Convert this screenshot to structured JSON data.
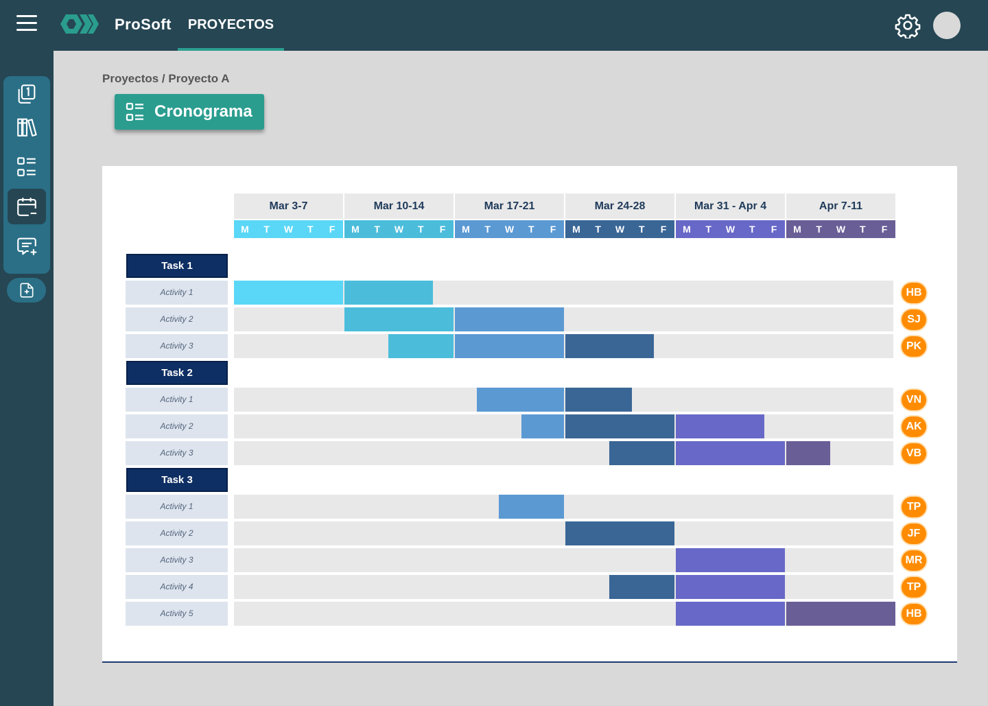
{
  "app": {
    "brand": "ProSoft",
    "nav_tab": "PROYECTOS"
  },
  "breadcrumb": "Proyectos / Proyecto A",
  "page_button": {
    "label": "Cronograma",
    "icon": "schedule-list-icon"
  },
  "sidebar": {
    "items": [
      {
        "name": "duplicate-icon",
        "active": false
      },
      {
        "name": "library-icon",
        "active": false
      },
      {
        "name": "list-icon",
        "active": false
      },
      {
        "name": "calendar-icon",
        "active": true
      },
      {
        "name": "comment-add-icon",
        "active": false
      }
    ],
    "add_item": "file-add-icon"
  },
  "colors": {
    "topbar": "#264653",
    "accent": "#2a9d8f",
    "badge": "#ff8c00",
    "week_colors": [
      "#5ad7f6",
      "#4bbddb",
      "#5b99d3",
      "#3a6696",
      "#6868c8",
      "#6a5e97"
    ]
  },
  "chart_data": {
    "type": "gantt",
    "weeks": [
      "Mar 3-7",
      "Mar 10-14",
      "Mar 17-21",
      "Mar 24-28",
      "Mar 31 - Apr 4",
      "Apr 7-11"
    ],
    "day_labels": [
      "M",
      "T",
      "W",
      "T",
      "F"
    ],
    "groups": [
      {
        "task": "Task 1",
        "activities": [
          {
            "label": "Activity 1",
            "assignee": "HB",
            "start": 0,
            "end": 1.8
          },
          {
            "label": "Activity 2",
            "assignee": "SJ",
            "start": 1,
            "end": 3
          },
          {
            "label": "Activity 3",
            "assignee": "PK",
            "start": 1.4,
            "end": 3.8
          }
        ]
      },
      {
        "task": "Task 2",
        "activities": [
          {
            "label": "Activity 1",
            "assignee": "VN",
            "start": 2.2,
            "end": 3.6
          },
          {
            "label": "Activity 2",
            "assignee": "AK",
            "start": 2.6,
            "end": 4.8
          },
          {
            "label": "Activity 3",
            "assignee": "VB",
            "start": 3.4,
            "end": 5.4
          }
        ]
      },
      {
        "task": "Task 3",
        "activities": [
          {
            "label": "Activity 1",
            "assignee": "TP",
            "start": 2.4,
            "end": 3
          },
          {
            "label": "Activity 2",
            "assignee": "JF",
            "start": 3,
            "end": 4
          },
          {
            "label": "Activity 3",
            "assignee": "MR",
            "start": 4,
            "end": 5
          },
          {
            "label": "Activity 4",
            "assignee": "TP",
            "start": 3.4,
            "end": 5
          },
          {
            "label": "Activity 5",
            "assignee": "HB",
            "start": 4,
            "end": 6
          }
        ]
      }
    ]
  }
}
